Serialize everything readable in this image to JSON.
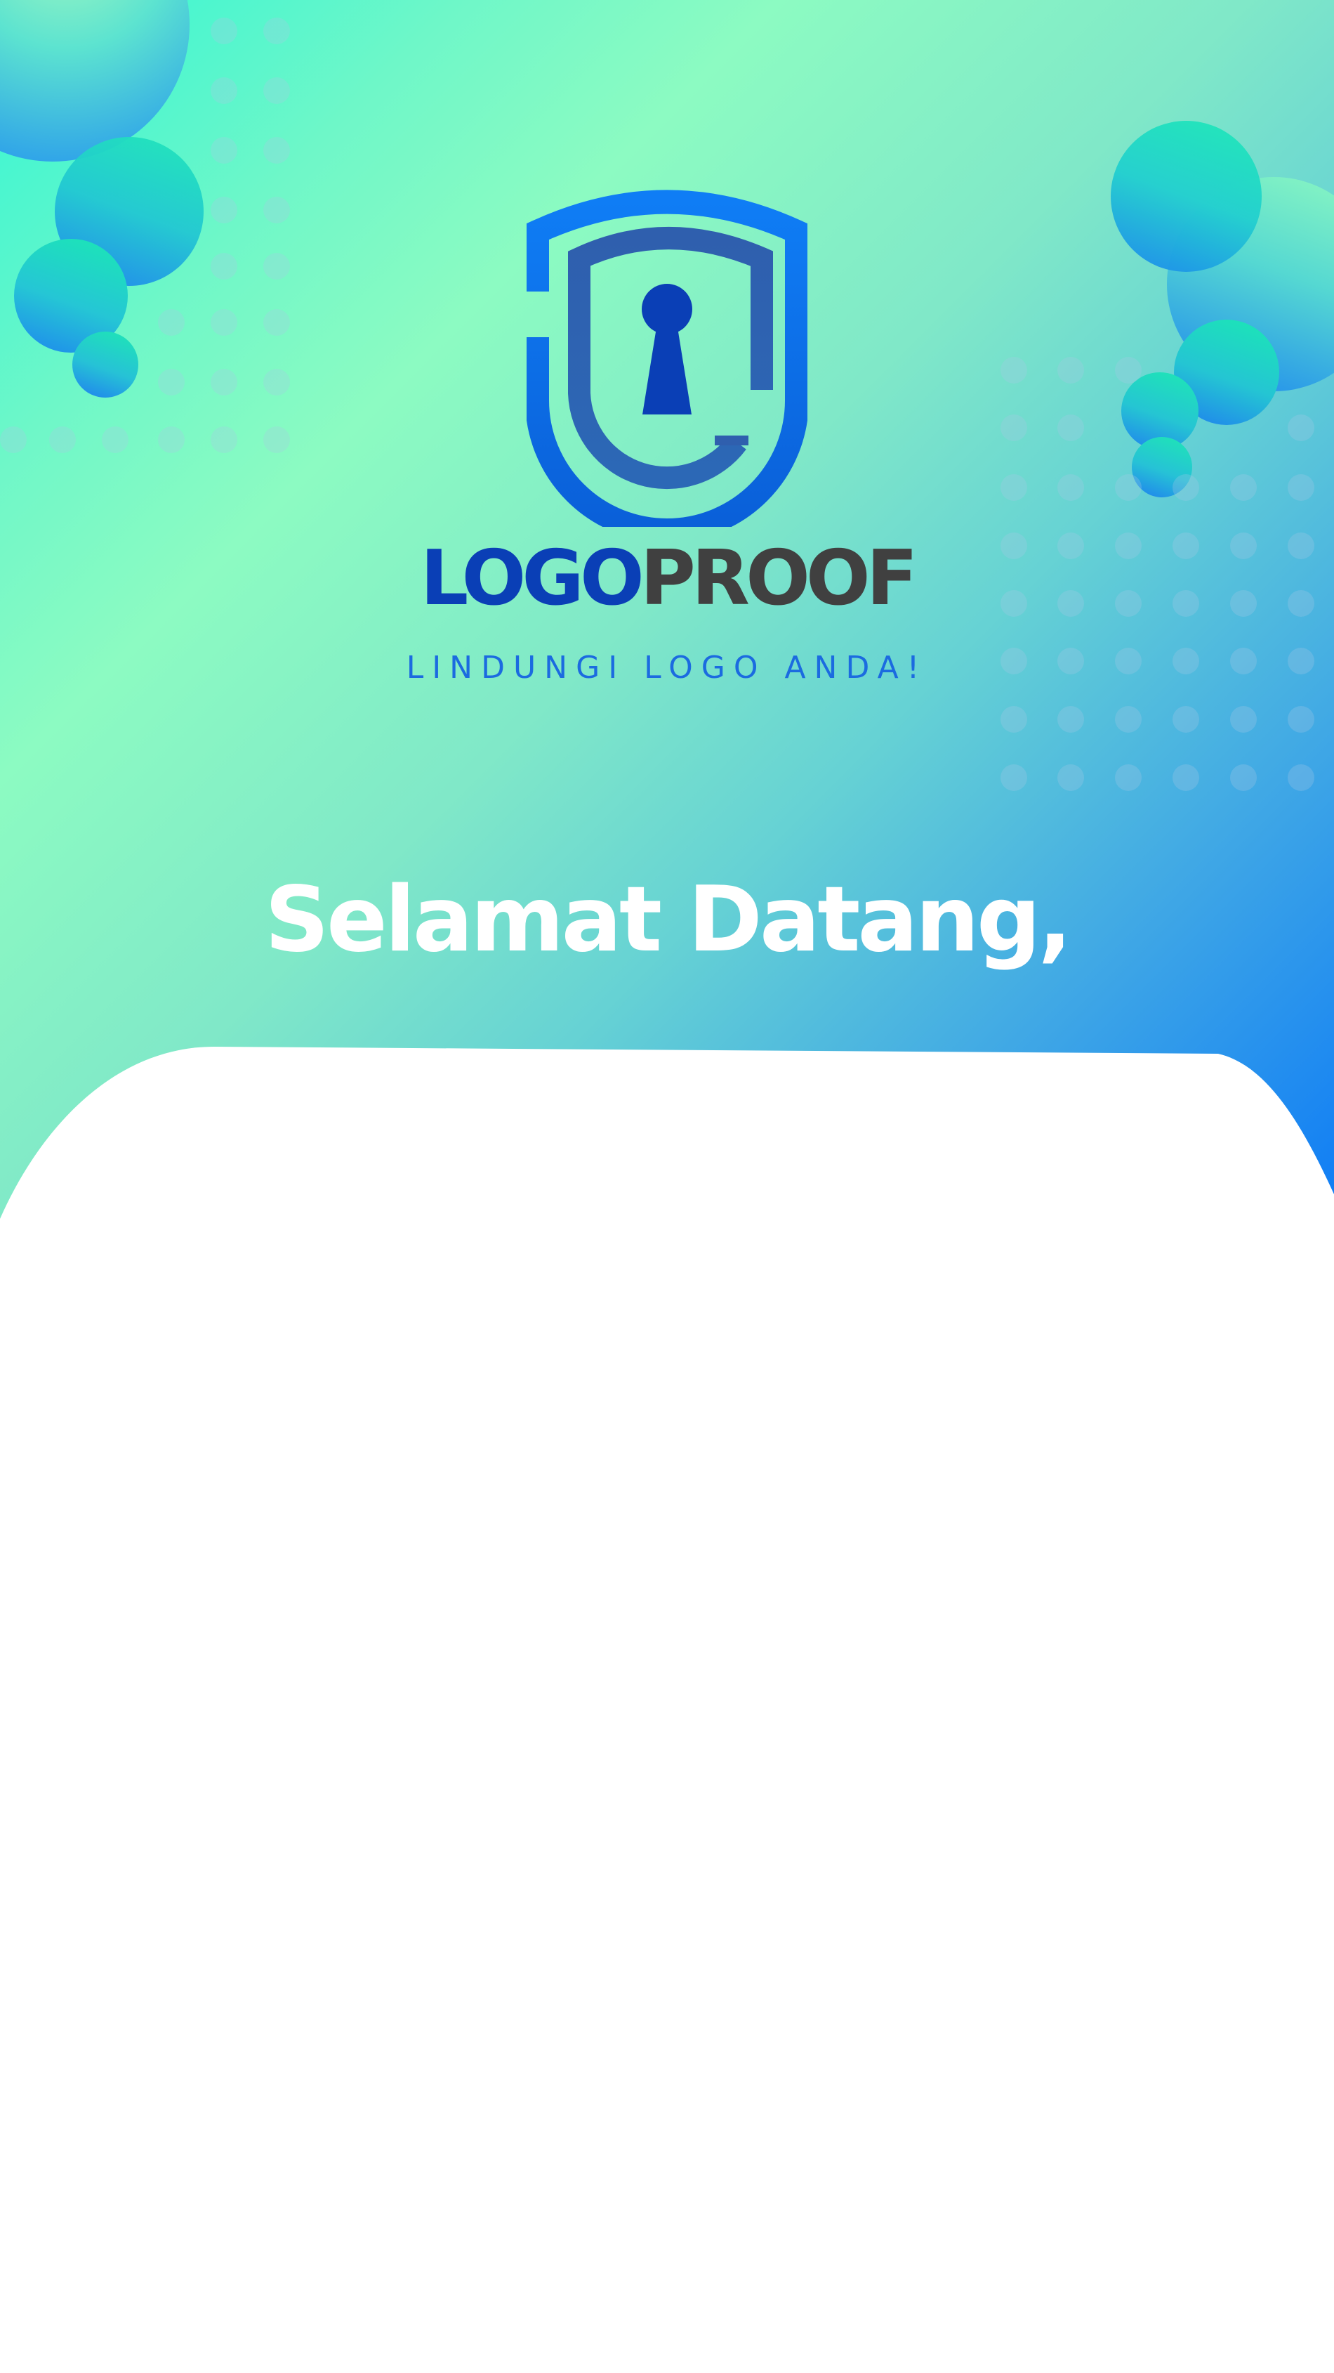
{
  "app": {
    "brand_first": "LOGO",
    "brand_second": "PROOF",
    "tagline": "LINDUNGI LOGO ANDA!",
    "logo_icon": "shield-keyhole-icon"
  },
  "welcome": {
    "heading": "Selamat Datang,"
  },
  "colors": {
    "gradient_start": "#33f5d4",
    "gradient_mid": "#8cfbc2",
    "gradient_end": "#0a78f7",
    "brand_blue": "#0a3fb6",
    "brand_gray": "#404040",
    "tagline_blue": "#1b6be0",
    "sheet": "#ffffff"
  }
}
